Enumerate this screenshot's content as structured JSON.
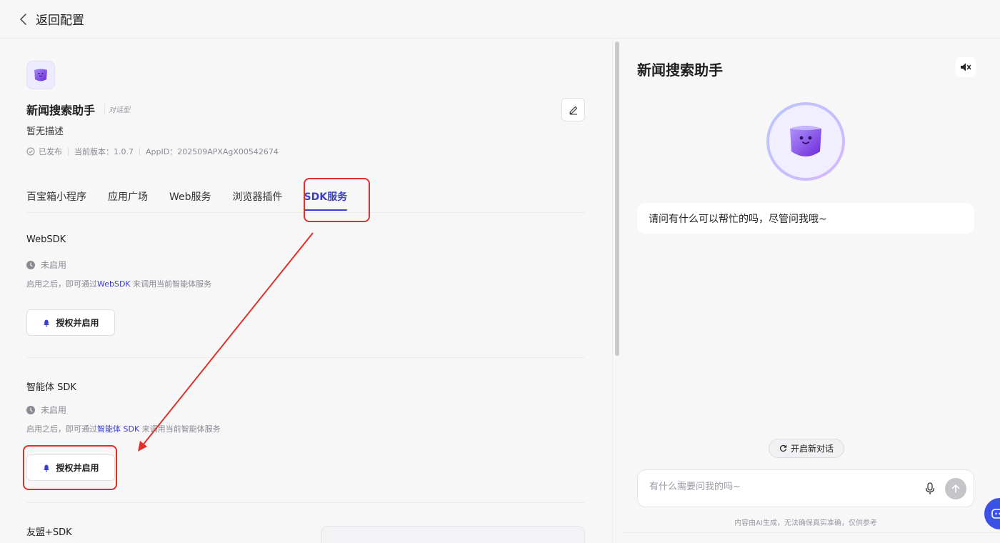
{
  "topbar": {
    "back_label": "返回配置"
  },
  "app": {
    "name": "新闻搜索助手",
    "type_tag": "对话型",
    "description": "暂无描述",
    "status": "已发布",
    "version": "当前版本：1.0.7",
    "app_id": "AppID：202509APXAgX00542674"
  },
  "tabs": [
    {
      "label": "百宝箱小程序",
      "active": false
    },
    {
      "label": "应用广场",
      "active": false
    },
    {
      "label": "Web服务",
      "active": false
    },
    {
      "label": "浏览器插件",
      "active": false
    },
    {
      "label": "SDK服务",
      "active": true
    }
  ],
  "sections": {
    "websdk": {
      "title": "WebSDK",
      "status": "未启用",
      "hint_prefix": "启用之后，即可通过",
      "hint_link": "WebSDK",
      "hint_suffix": " 来调用当前智能体服务",
      "button": "授权并启用"
    },
    "agent_sdk": {
      "title": "智能体 SDK",
      "status": "未启用",
      "hint_prefix": "启用之后，即可通过",
      "hint_link": "智能体 SDK",
      "hint_suffix": " 来调用当前智能体服务",
      "button": "授权并启用"
    },
    "umeng": {
      "title": "友盟+SDK"
    }
  },
  "chat": {
    "title": "新闻搜索助手",
    "greeting": "请问有什么可以帮忙的吗，尽管问我哦~",
    "new_chat_label": "开启新对话",
    "input_placeholder": "有什么需要问我的吗~",
    "disclaimer": "内容由AI生成，无法确保真实准确，仅供参考"
  },
  "colors": {
    "accent": "#3b3fcf",
    "annotation_red": "#e0302a",
    "avatar_purple": "#8b5cf6"
  }
}
